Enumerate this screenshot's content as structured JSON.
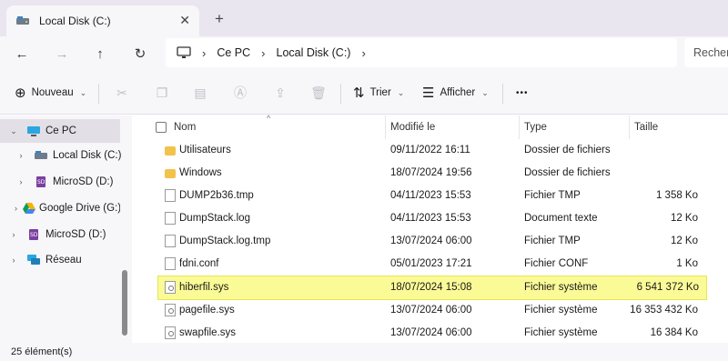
{
  "tab": {
    "title": "Local Disk (C:)",
    "close": "✕",
    "new": "+"
  },
  "breadcrumb": [
    "Ce PC",
    "Local Disk (C:)"
  ],
  "search_placeholder": "Rechercher",
  "toolbar": {
    "new_label": "Nouveau",
    "sort_label": "Trier",
    "view_label": "Afficher",
    "more": "•••"
  },
  "sidebar": {
    "items": [
      {
        "label": "Ce PC",
        "icon": "computer-icon"
      },
      {
        "label": "Local Disk (C:)",
        "icon": "drive-icon"
      },
      {
        "label": "MicroSD (D:)",
        "icon": "sd-icon"
      },
      {
        "label": "Google Drive (G:)",
        "icon": "google-drive-icon"
      },
      {
        "label": "MicroSD (D:)",
        "icon": "sd-icon"
      },
      {
        "label": "Réseau",
        "icon": "network-icon"
      }
    ]
  },
  "columns": {
    "name": "Nom",
    "modified": "Modifié le",
    "type": "Type",
    "size": "Taille"
  },
  "files": [
    {
      "name": "Utilisateurs",
      "modified": "09/11/2022 16:11",
      "type": "Dossier de fichiers",
      "size": "",
      "kind": "folder"
    },
    {
      "name": "Windows",
      "modified": "18/07/2024 19:56",
      "type": "Dossier de fichiers",
      "size": "",
      "kind": "folder"
    },
    {
      "name": "DUMP2b36.tmp",
      "modified": "04/11/2023 15:53",
      "type": "Fichier TMP",
      "size": "1 358 Ko",
      "kind": "file"
    },
    {
      "name": "DumpStack.log",
      "modified": "04/11/2023 15:53",
      "type": "Document texte",
      "size": "12 Ko",
      "kind": "file"
    },
    {
      "name": "DumpStack.log.tmp",
      "modified": "13/07/2024 06:00",
      "type": "Fichier TMP",
      "size": "12 Ko",
      "kind": "file"
    },
    {
      "name": "fdni.conf",
      "modified": "05/01/2023 17:21",
      "type": "Fichier CONF",
      "size": "1 Ko",
      "kind": "file"
    },
    {
      "name": "hiberfil.sys",
      "modified": "18/07/2024 15:08",
      "type": "Fichier système",
      "size": "6 541 372 Ko",
      "kind": "sys",
      "highlighted": true
    },
    {
      "name": "pagefile.sys",
      "modified": "13/07/2024 06:00",
      "type": "Fichier système",
      "size": "16 353 432 Ko",
      "kind": "sys"
    },
    {
      "name": "swapfile.sys",
      "modified": "13/07/2024 06:00",
      "type": "Fichier système",
      "size": "16 384 Ko",
      "kind": "sys"
    }
  ],
  "status": "25 élément(s)",
  "colors": {
    "highlight": "#fafa97",
    "folder": "#f2c24a",
    "accent": "#1a73e8"
  }
}
